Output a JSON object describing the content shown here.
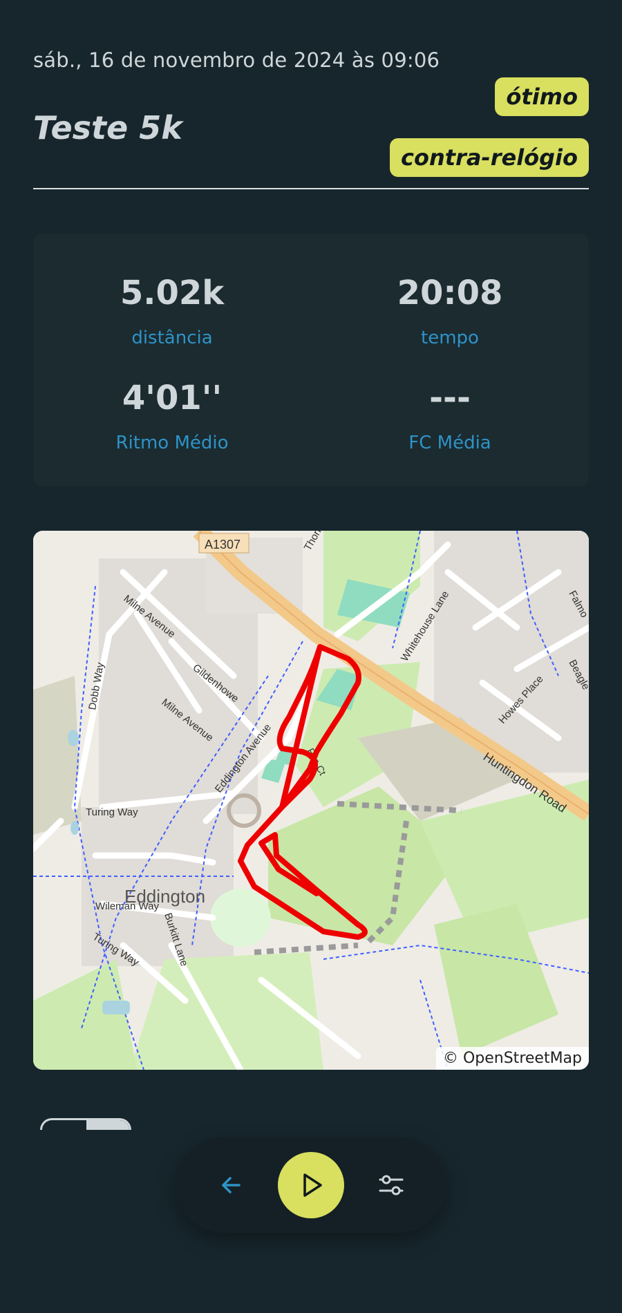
{
  "header": {
    "datetime": "sáb., 16 de novembro de 2024 às 09:06",
    "title": "Teste 5k",
    "tags": [
      "ótimo",
      "contra-relógio"
    ]
  },
  "stats": [
    {
      "value": "5.02k",
      "label": "distância"
    },
    {
      "value": "20:08",
      "label": "tempo"
    },
    {
      "value": "4'01''",
      "label": "Ritmo Médio"
    },
    {
      "value": "---",
      "label": "FC Média"
    }
  ],
  "map": {
    "labels": {
      "road_a": "A1307",
      "road_b": "Huntingdon Road",
      "street1": "Milne Avenue",
      "street2": "Milne Avenue",
      "street3": "Gildenhowe",
      "street4": "Eddington Avenue",
      "street5": "Dobb Way",
      "street6": "Turing Way",
      "street7": "Wileman Way",
      "street8": "Turing Way",
      "street9": "Burkitt Lane",
      "street10": "Whitehouse Lane",
      "street11": "Howes Place",
      "street12": "Beagle",
      "street13": "Falmo",
      "street14": "Thorn",
      "street15": "Pye Ct",
      "place": "Eddington"
    },
    "attribution": "© OpenStreetMap",
    "route_color": "#ee0000"
  },
  "nav": {
    "back_icon": "arrow-left-icon",
    "play_icon": "play-icon",
    "filter_icon": "sliders-icon"
  },
  "colors": {
    "background": "#17262d",
    "accent": "#d9df5f",
    "label_blue": "#2e93c7"
  }
}
